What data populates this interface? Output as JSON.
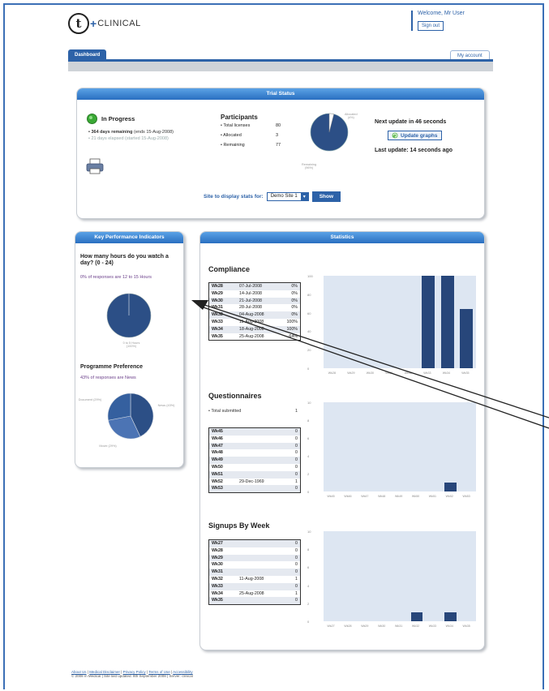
{
  "brand": {
    "logo_t": "t",
    "logo_plus": "+",
    "logo_word": "CLINICAL"
  },
  "header": {
    "welcome": "Welcome, Mr User",
    "signout": "Sign out"
  },
  "tabs": {
    "dashboard": "Dashboard",
    "account": "My account"
  },
  "trial_status": {
    "title": "Trial Status",
    "status_label": "In Progress",
    "days_remaining": "• 364 days remaining",
    "days_remaining_note": "(ends 15-Aug-2008)",
    "days_elapsed": "• 21 days elapsed (started 15-Aug-2008)",
    "participants_title": "Participants",
    "participants": [
      {
        "label": "• Total licenses",
        "value": "80"
      },
      {
        "label": "• Allocated",
        "value": "3"
      },
      {
        "label": "• Remaining",
        "value": "77"
      }
    ],
    "pie": {
      "allocated_label": "Allocated",
      "allocated_pct": "(4%)",
      "remaining_label": "Remaining",
      "remaining_pct": "(96%)",
      "allocated_fraction": 0.04
    },
    "next_update": "Next update in 46 seconds",
    "update_button": "Update graphs",
    "last_update": "Last update: 14 seconds ago",
    "site_label": "Site to display stats for:",
    "site_value": "Demo Site 1",
    "show_button": "Show"
  },
  "kpi": {
    "title": "Key Performance Indicators",
    "q1": "How many hours do you watch a day? (0 - 24)",
    "q1_summary": "0% of responses are 12 to 15 Hours",
    "q1_pie_label": "0 to 5 Hours (100%)",
    "q2": "Programme Preference",
    "q2_summary": "43% of responses are News",
    "q2_slices": [
      {
        "label": "News (43%)",
        "fraction": 0.43,
        "color": "#2c4f86"
      },
      {
        "label": "Movie (29%)",
        "fraction": 0.29,
        "color": "#4c74b4"
      },
      {
        "label": "Document (29%)",
        "fraction": 0.28,
        "color": "#35609f"
      }
    ]
  },
  "statistics": {
    "title": "Statistics",
    "compliance": {
      "title": "Compliance",
      "rows": [
        [
          "Wk28",
          "07-Jul-2008",
          "0%"
        ],
        [
          "Wk29",
          "14-Jul-2008",
          "0%"
        ],
        [
          "Wk30",
          "21-Jul-2008",
          "0%"
        ],
        [
          "Wk31",
          "28-Jul-2008",
          "0%"
        ],
        [
          "Wk32",
          "04-Aug-2008",
          "0%"
        ],
        [
          "Wk33",
          "11-Aug-2008",
          "100%"
        ],
        [
          "Wk34",
          "18-Aug-2008",
          "100%"
        ],
        [
          "Wk35",
          "25-Aug-2008",
          "64%"
        ]
      ],
      "y_ticks": [
        "100",
        "80",
        "60",
        "40",
        "20",
        "0"
      ],
      "x_ticks": [
        "Wk28",
        "Wk29",
        "Wk30",
        "Wk31",
        "Wk32",
        "Wk33",
        "Wk34",
        "Wk35"
      ],
      "values": [
        0,
        0,
        0,
        0,
        0,
        100,
        100,
        64
      ],
      "ymax": 100
    },
    "questionnaires": {
      "title": "Questionnaires",
      "total_label": "• Total submitted",
      "total_value": "1",
      "rows": [
        [
          "Wk45",
          "",
          "0"
        ],
        [
          "Wk46",
          "",
          "0"
        ],
        [
          "Wk47",
          "",
          "0"
        ],
        [
          "Wk48",
          "",
          "0"
        ],
        [
          "Wk49",
          "",
          "0"
        ],
        [
          "Wk50",
          "",
          "0"
        ],
        [
          "Wk51",
          "",
          "0"
        ],
        [
          "Wk52",
          "29-Dec-1969",
          "1"
        ],
        [
          "Wk53",
          "",
          "0"
        ]
      ],
      "y_ticks": [
        "10",
        "8",
        "6",
        "4",
        "2",
        "0"
      ],
      "x_ticks": [
        "Wk45",
        "Wk46",
        "Wk47",
        "Wk48",
        "Wk49",
        "Wk50",
        "Wk51",
        "Wk52",
        "Wk53"
      ],
      "values": [
        0,
        0,
        0,
        0,
        0,
        0,
        0,
        1,
        0
      ],
      "ymax": 10
    },
    "signups": {
      "title": "Signups By Week",
      "rows": [
        [
          "Wk27",
          "",
          "0"
        ],
        [
          "Wk28",
          "",
          "0"
        ],
        [
          "Wk29",
          "",
          "0"
        ],
        [
          "Wk30",
          "",
          "0"
        ],
        [
          "Wk31",
          "",
          "0"
        ],
        [
          "Wk32",
          "11-Aug-2008",
          "1"
        ],
        [
          "Wk33",
          "",
          "0"
        ],
        [
          "Wk34",
          "25-Aug-2008",
          "1"
        ],
        [
          "Wk35",
          "",
          "0"
        ]
      ],
      "y_ticks": [
        "10",
        "8",
        "6",
        "4",
        "2",
        "0"
      ],
      "x_ticks": [
        "Wk27",
        "Wk28",
        "Wk29",
        "Wk30",
        "Wk31",
        "Wk32",
        "Wk33",
        "Wk34",
        "Wk35"
      ],
      "values": [
        0,
        0,
        0,
        0,
        0,
        1,
        0,
        1,
        0
      ],
      "ymax": 10
    }
  },
  "footer": {
    "links": [
      "About Us",
      "Medical Disclaimer",
      "Privacy Policy",
      "Terms of Use",
      "Accessibility"
    ],
    "copyright": "© 2008 m Medical | Site last updated: 8th September 2008 | Server: clinical"
  },
  "colors": {
    "accent": "#2d62a8",
    "bar": "#27467a",
    "chart_bg": "#dde6f2",
    "status_green": "#3aa935"
  }
}
